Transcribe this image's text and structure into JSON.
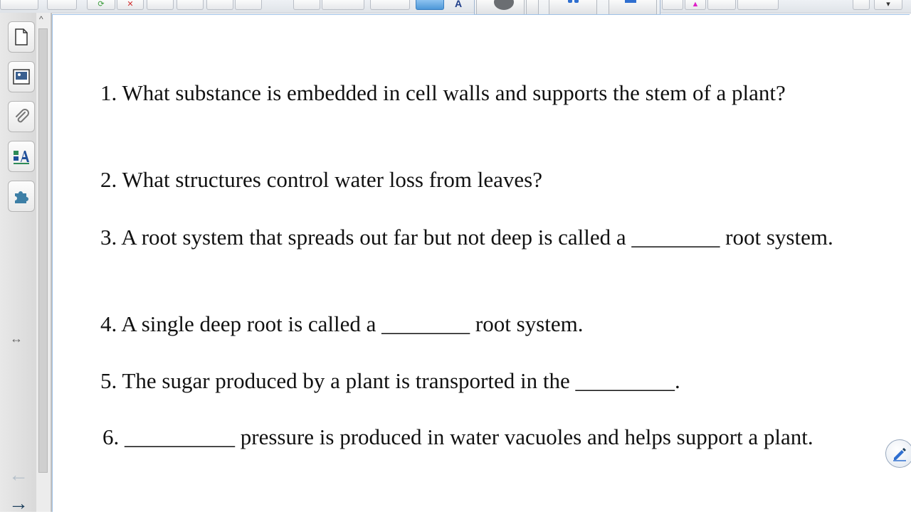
{
  "toolbar": {
    "text_tool_glyph": "A"
  },
  "side_tabs": {
    "items": [
      "page-sorter",
      "gallery",
      "attachments",
      "properties",
      "add-ons"
    ],
    "resize_glyph": "↔",
    "back_glyph": "←",
    "forward_glyph": "→"
  },
  "scrollbar": {
    "up_glyph": "^"
  },
  "worksheet": {
    "questions": [
      {
        "text": "1. What substance is embedded in cell walls and supports the stem of a plant?"
      },
      {
        "text": "2. What structures control water loss from leaves?"
      },
      {
        "text": "3. A root system that spreads out far but not deep is called a ________ root system."
      },
      {
        "text": "4.  A single deep root is called a ________ root system."
      },
      {
        "text": "5. The sugar produced by a plant is transported in the _________."
      },
      {
        "text": "6. __________ pressure is produced in water vacuoles and helps support a plant."
      }
    ]
  },
  "colors": {
    "canvas_border": "#9ec1e6",
    "active_tool": "#4d97d8",
    "nav_forward": "#1d3f5c"
  }
}
